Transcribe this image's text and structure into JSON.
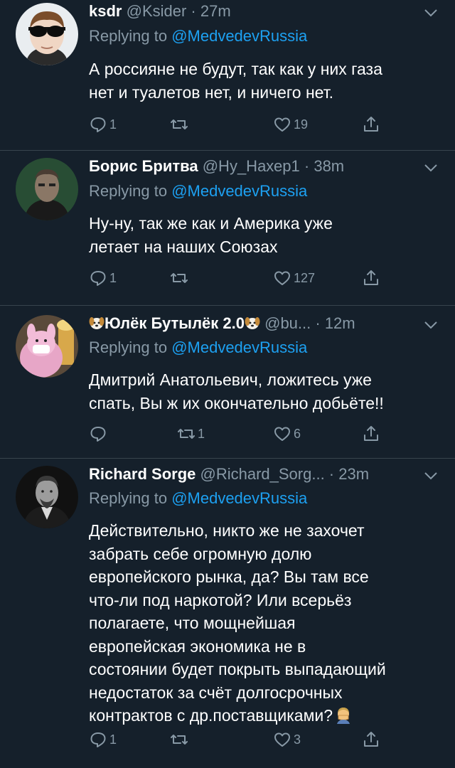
{
  "reply_prefix": "Replying to ",
  "tweets": [
    {
      "name": "ksdr",
      "handle": "@Ksider",
      "time": "27m",
      "mention": "@MedvedevRussia",
      "text": "А россияне не будут, так как у них газа\nнет и туалетов нет, и ничего нет.",
      "replies": "1",
      "retweets": "",
      "likes": "19"
    },
    {
      "name": "Борис Бритва",
      "handle": "@Ну_Нахер1",
      "time": "38m",
      "mention": "@MedvedevRussia",
      "text": "Ну-ну, так же как и Америка уже\nлетает на наших Союзах",
      "replies": "1",
      "retweets": "",
      "likes": "127"
    },
    {
      "name": "Юлёк Бутылёк 2.0",
      "handle": "@bu...",
      "time": "12m",
      "mention": "@MedvedevRussia",
      "text": "Дмитрий Анатольевич, ложитесь уже\nспать, Вы ж их окончательно добьёте!!",
      "replies": "",
      "retweets": "1",
      "likes": "6"
    },
    {
      "name": "Richard Sorge",
      "handle": "@Richard_Sorg...",
      "time": "23m",
      "mention": "@MedvedevRussia",
      "text": "Действительно, никто же не захочет\nзабрать себе огромную долю\nевропейского рынка, да? Вы там все\nчто-ли под наркотой? Или всерьёз\nполагаете, что мощнейшая\nевропейская экономика не в\nсостоянии будет покрыть выпадающий\nнедостаток за счёт долгосрочных\nконтрактов с др.поставщиками?",
      "replies": "1",
      "retweets": "",
      "likes": "3"
    }
  ],
  "icons": {
    "reply": "reply-bubble-icon",
    "retweet": "retweet-icon",
    "like": "heart-icon",
    "share": "share-icon",
    "caret": "chevron-down-icon",
    "emoji_dog": "dog-face-emoji",
    "emoji_facepalm": "facepalm-emoji"
  },
  "colors": {
    "background": "#15202b",
    "text": "#ffffff",
    "secondary": "#8899a6",
    "link": "#1da1f2",
    "divider": "#38444d"
  }
}
